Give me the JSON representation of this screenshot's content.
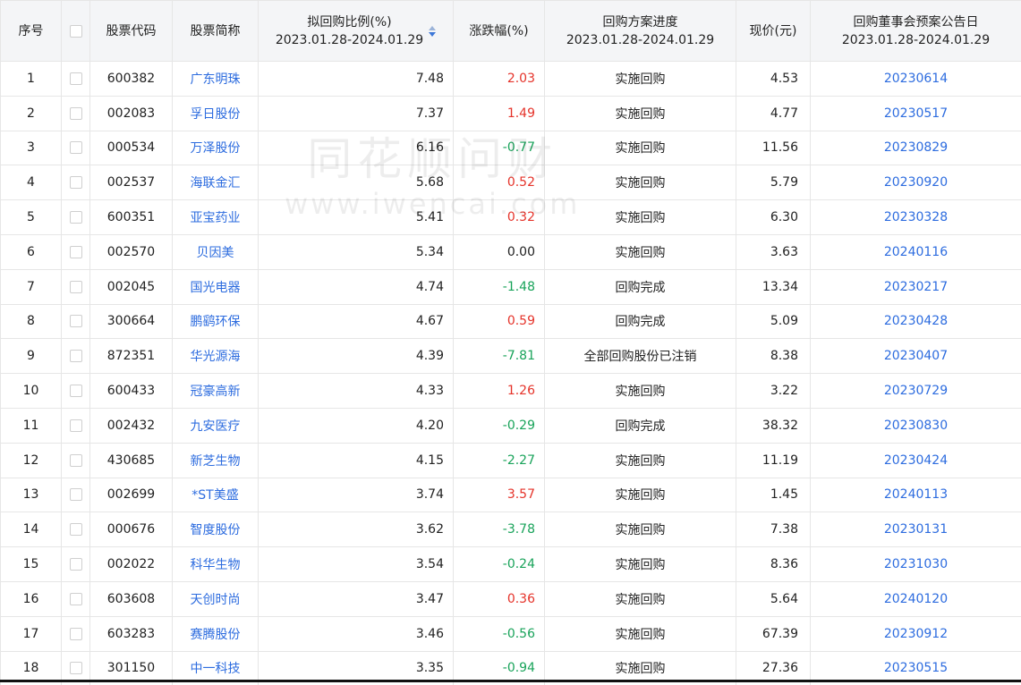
{
  "header": {
    "idx": "序号",
    "code": "股票代码",
    "name": "股票简称",
    "ratio_l1": "拟回购比例(%)",
    "ratio_l2": "2023.01.28-2024.01.29",
    "chg": "涨跌幅(%)",
    "prog_l1": "回购方案进度",
    "prog_l2": "2023.01.28-2024.01.29",
    "price": "现价(元)",
    "date_l1": "回购董事会预案公告日",
    "date_l2": "2023.01.28-2024.01.29"
  },
  "watermark": {
    "main": "同花顺问财",
    "url": "www.iwencai.com"
  },
  "colors": {
    "link": "#2d6cdf",
    "up": "#e5332a",
    "down": "#19a35a",
    "header_bg": "#f4f5f7"
  },
  "rows": [
    {
      "idx": "1",
      "code": "600382",
      "name": "广东明珠",
      "ratio": "7.48",
      "chg": "2.03",
      "dir": "up",
      "prog": "实施回购",
      "price": "4.53",
      "date": "20230614"
    },
    {
      "idx": "2",
      "code": "002083",
      "name": "孚日股份",
      "ratio": "7.37",
      "chg": "1.49",
      "dir": "up",
      "prog": "实施回购",
      "price": "4.77",
      "date": "20230517"
    },
    {
      "idx": "3",
      "code": "000534",
      "name": "万泽股份",
      "ratio": "6.16",
      "chg": "-0.77",
      "dir": "down",
      "prog": "实施回购",
      "price": "11.56",
      "date": "20230829"
    },
    {
      "idx": "4",
      "code": "002537",
      "name": "海联金汇",
      "ratio": "5.68",
      "chg": "0.52",
      "dir": "up",
      "prog": "实施回购",
      "price": "5.79",
      "date": "20230920"
    },
    {
      "idx": "5",
      "code": "600351",
      "name": "亚宝药业",
      "ratio": "5.41",
      "chg": "0.32",
      "dir": "up",
      "prog": "实施回购",
      "price": "6.30",
      "date": "20230328"
    },
    {
      "idx": "6",
      "code": "002570",
      "name": "贝因美",
      "ratio": "5.34",
      "chg": "0.00",
      "dir": "flat",
      "prog": "实施回购",
      "price": "3.63",
      "date": "20240116"
    },
    {
      "idx": "7",
      "code": "002045",
      "name": "国光电器",
      "ratio": "4.74",
      "chg": "-1.48",
      "dir": "down",
      "prog": "回购完成",
      "price": "13.34",
      "date": "20230217"
    },
    {
      "idx": "8",
      "code": "300664",
      "name": "鹏鹞环保",
      "ratio": "4.67",
      "chg": "0.59",
      "dir": "up",
      "prog": "回购完成",
      "price": "5.09",
      "date": "20230428"
    },
    {
      "idx": "9",
      "code": "872351",
      "name": "华光源海",
      "ratio": "4.39",
      "chg": "-7.81",
      "dir": "down",
      "prog": "全部回购股份已注销",
      "price": "8.38",
      "date": "20230407"
    },
    {
      "idx": "10",
      "code": "600433",
      "name": "冠豪高新",
      "ratio": "4.33",
      "chg": "1.26",
      "dir": "up",
      "prog": "实施回购",
      "price": "3.22",
      "date": "20230729"
    },
    {
      "idx": "11",
      "code": "002432",
      "name": "九安医疗",
      "ratio": "4.20",
      "chg": "-0.29",
      "dir": "down",
      "prog": "回购完成",
      "price": "38.32",
      "date": "20230830"
    },
    {
      "idx": "12",
      "code": "430685",
      "name": "新芝生物",
      "ratio": "4.15",
      "chg": "-2.27",
      "dir": "down",
      "prog": "实施回购",
      "price": "11.19",
      "date": "20230424"
    },
    {
      "idx": "13",
      "code": "002699",
      "name": "*ST美盛",
      "ratio": "3.74",
      "chg": "3.57",
      "dir": "up",
      "prog": "实施回购",
      "price": "1.45",
      "date": "20240113"
    },
    {
      "idx": "14",
      "code": "000676",
      "name": "智度股份",
      "ratio": "3.62",
      "chg": "-3.78",
      "dir": "down",
      "prog": "实施回购",
      "price": "7.38",
      "date": "20230131"
    },
    {
      "idx": "15",
      "code": "002022",
      "name": "科华生物",
      "ratio": "3.54",
      "chg": "-0.24",
      "dir": "down",
      "prog": "实施回购",
      "price": "8.36",
      "date": "20231030"
    },
    {
      "idx": "16",
      "code": "603608",
      "name": "天创时尚",
      "ratio": "3.47",
      "chg": "0.36",
      "dir": "up",
      "prog": "实施回购",
      "price": "5.64",
      "date": "20240120"
    },
    {
      "idx": "17",
      "code": "603283",
      "name": "赛腾股份",
      "ratio": "3.46",
      "chg": "-0.56",
      "dir": "down",
      "prog": "实施回购",
      "price": "67.39",
      "date": "20230912"
    },
    {
      "idx": "18",
      "code": "301150",
      "name": "中一科技",
      "ratio": "3.35",
      "chg": "-0.94",
      "dir": "down",
      "prog": "实施回购",
      "price": "27.36",
      "date": "20230515"
    }
  ]
}
